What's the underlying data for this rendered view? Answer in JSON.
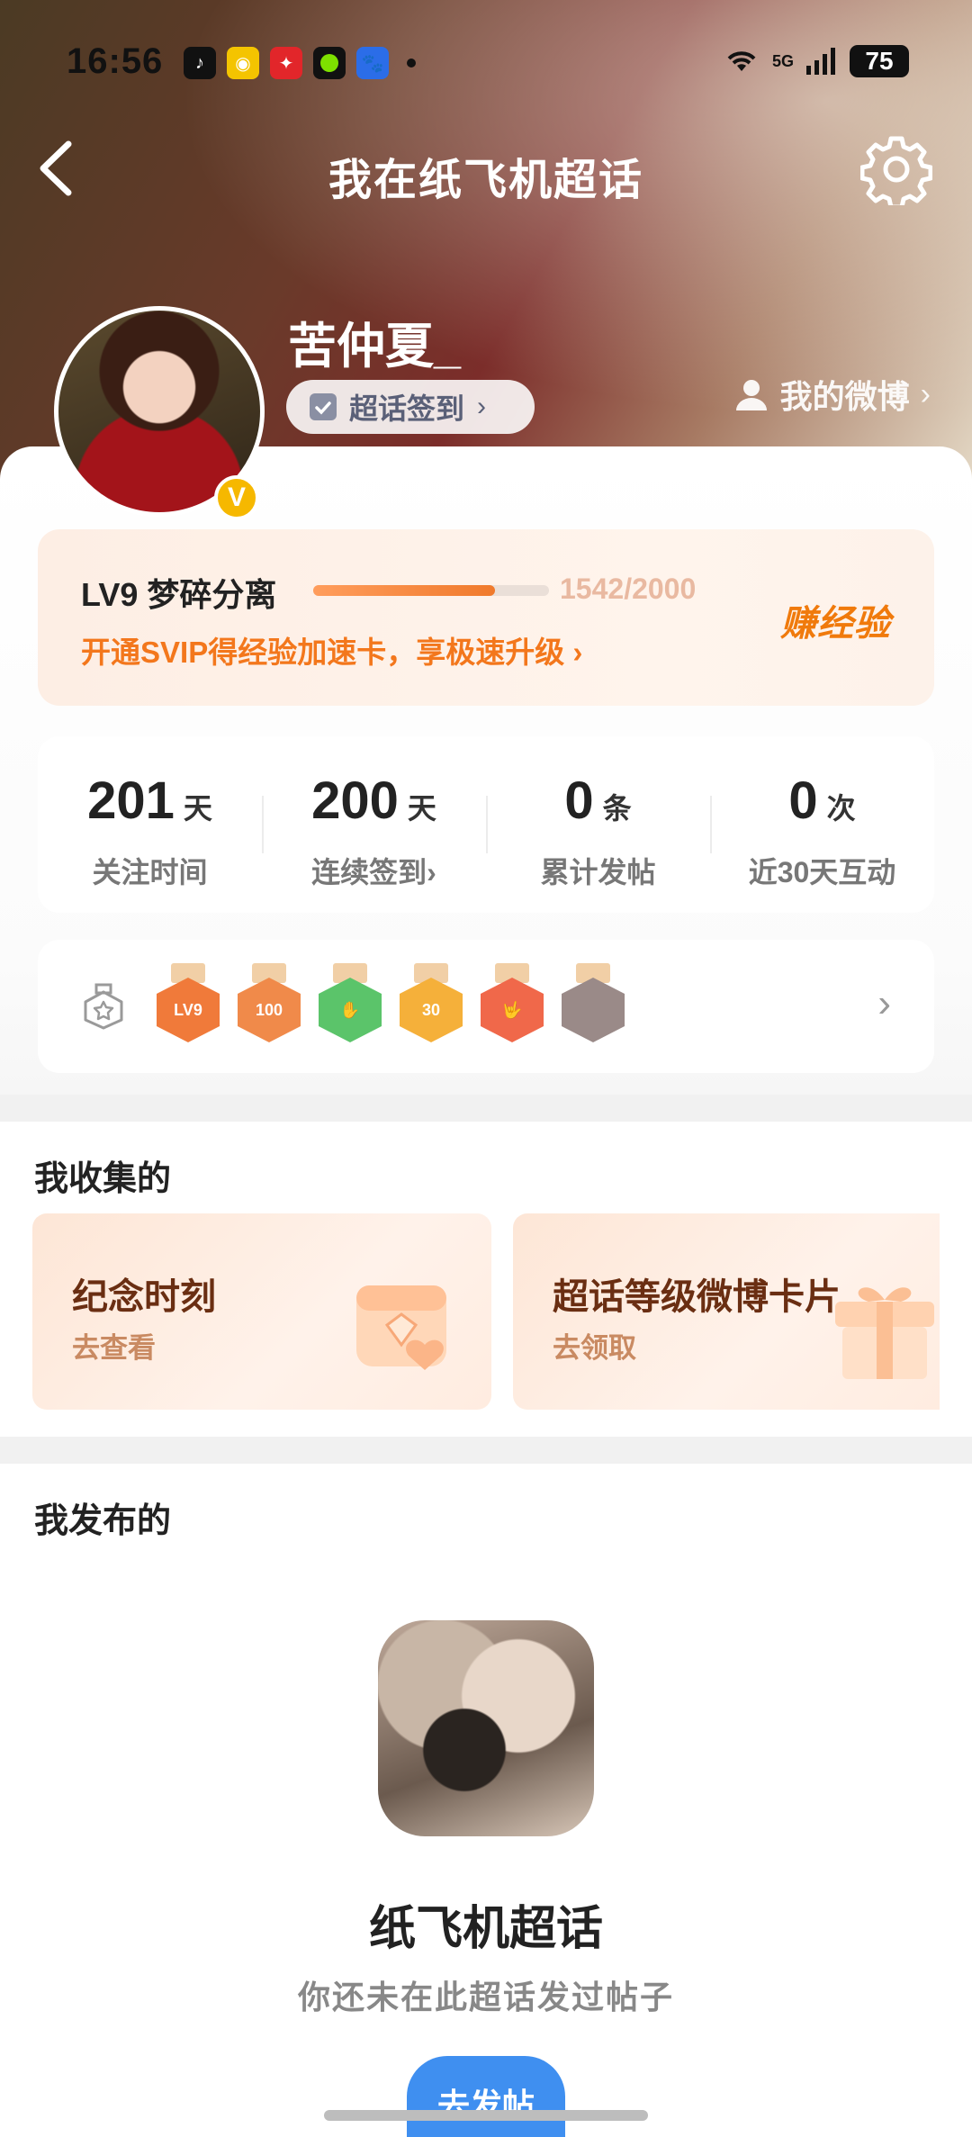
{
  "status_bar": {
    "time": "16:56",
    "network": "5G",
    "battery": "75",
    "app_icons": [
      "tiktok-icon",
      "weibo-icon",
      "lottery-icon",
      "green-dot-app-icon",
      "baidu-icon"
    ]
  },
  "nav": {
    "title": "我在纸飞机超话"
  },
  "profile": {
    "username": "苦仲夏_",
    "verified_badge": "V",
    "checkin_label": "超话签到",
    "my_weibo_label": "我的微博"
  },
  "level": {
    "name": "LV9 梦碎分离",
    "progress": 0.771,
    "score": "1542/2000",
    "promo": "开通SVIP得经验加速卡，享极速升级",
    "earn_label": "赚经验"
  },
  "stats": [
    {
      "num": "201",
      "unit": "天",
      "label": "关注时间",
      "chevron": ""
    },
    {
      "num": "200",
      "unit": "天",
      "label": "连续签到",
      "chevron": "›"
    },
    {
      "num": "0",
      "unit": "条",
      "label": "累计发帖",
      "chevron": ""
    },
    {
      "num": "0",
      "unit": "次",
      "label": "近30天互动",
      "chevron": ""
    }
  ],
  "badges": {
    "items": [
      {
        "text": "LV9",
        "color": "#f07a3a"
      },
      {
        "text": "100",
        "color": "#f08a4a"
      },
      {
        "text": "✋",
        "color": "#5bc46a"
      },
      {
        "text": "30",
        "color": "#f5b03a"
      },
      {
        "text": "🤟",
        "color": "#f0684a"
      },
      {
        "text": "",
        "color": "#9a8a88"
      }
    ]
  },
  "collections": {
    "title": "我收集的",
    "cards": [
      {
        "title": "纪念时刻",
        "sub": "去查看"
      },
      {
        "title": "超话等级微博卡片",
        "sub": "去领取"
      }
    ]
  },
  "published": {
    "title": "我发布的",
    "topic_name": "纸飞机超话",
    "hint": "你还未在此超话发过帖子",
    "post_button": "去发帖"
  }
}
